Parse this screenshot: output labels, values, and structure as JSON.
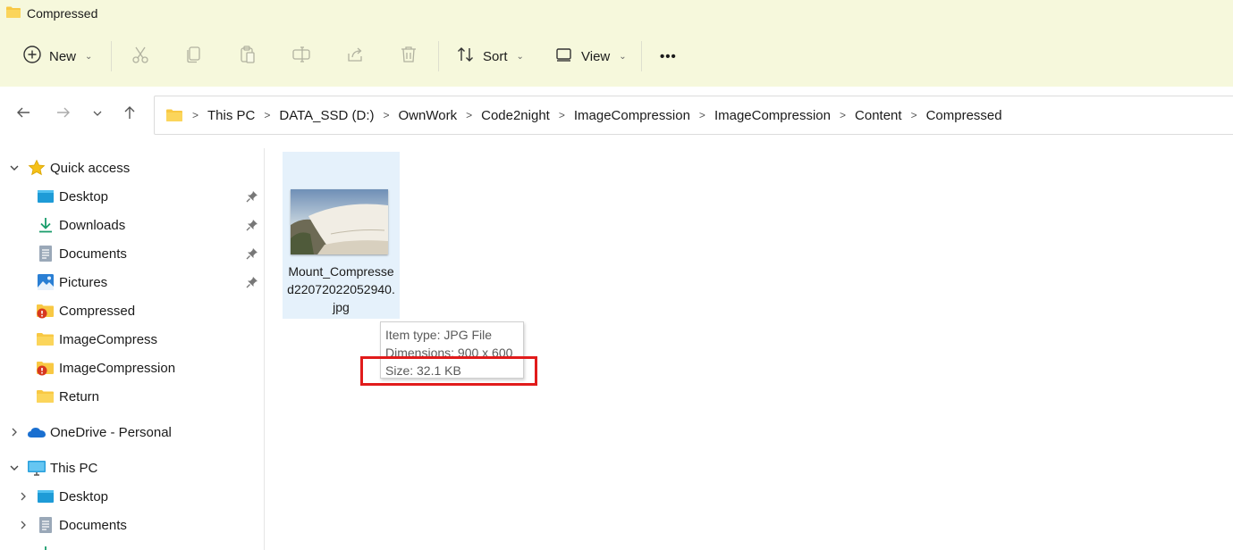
{
  "window": {
    "title": "Compressed"
  },
  "commands": {
    "new_label": "New",
    "sort_label": "Sort",
    "view_label": "View",
    "more_label": "•••"
  },
  "breadcrumb": [
    "This PC",
    "DATA_SSD (D:)",
    "OwnWork",
    "Code2night",
    "ImageCompression",
    "ImageCompression",
    "Content",
    "Compressed"
  ],
  "sidebar": {
    "quick_access": "Quick access",
    "items": [
      {
        "label": "Desktop",
        "icon": "desktop-icon",
        "pinned": true
      },
      {
        "label": "Downloads",
        "icon": "download-icon",
        "pinned": true
      },
      {
        "label": "Documents",
        "icon": "documents-icon",
        "pinned": true
      },
      {
        "label": "Pictures",
        "icon": "pictures-icon",
        "pinned": true
      },
      {
        "label": "Compressed",
        "icon": "folder-warning-icon",
        "pinned": false
      },
      {
        "label": "ImageCompress",
        "icon": "folder-icon",
        "pinned": false
      },
      {
        "label": "ImageCompression",
        "icon": "folder-warning-icon",
        "pinned": false
      },
      {
        "label": "Return",
        "icon": "folder-icon",
        "pinned": false
      }
    ],
    "onedrive": "OneDrive - Personal",
    "this_pc": "This PC",
    "this_pc_items": [
      {
        "label": "Desktop",
        "icon": "desktop-icon"
      },
      {
        "label": "Documents",
        "icon": "documents-icon"
      }
    ]
  },
  "file": {
    "name": "Mount_Compressed22072022052940.jpg"
  },
  "tooltip": {
    "type": "Item type: JPG File",
    "dimensions": "Dimensions: 900 x 600",
    "size": "Size: 32.1 KB"
  },
  "colors": {
    "topbar_bg": "#f6f8dc",
    "selection_bg": "#e5f1fb",
    "highlight_red": "#e11b1b",
    "folder_yellow": "#f8c843"
  }
}
